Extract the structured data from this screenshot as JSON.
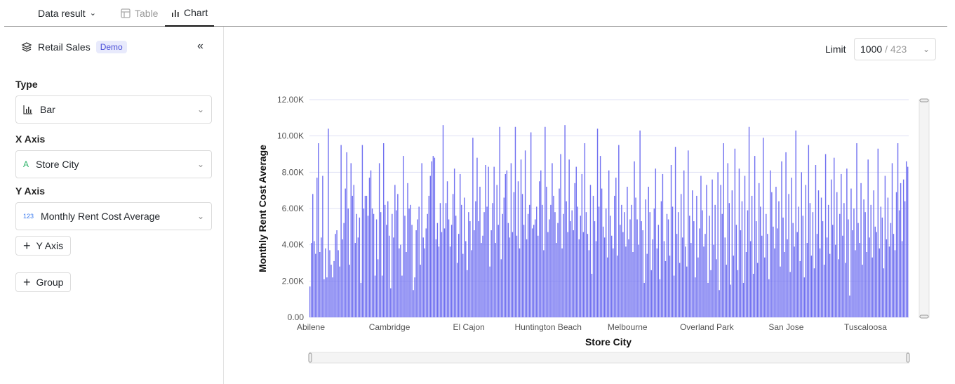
{
  "topbar": {
    "data_result": "Data result",
    "table_tab": "Table",
    "chart_tab": "Chart"
  },
  "sidebar": {
    "dataset": "Retail Sales",
    "badge": "Demo",
    "type_label": "Type",
    "type_value": "Bar",
    "x_label": "X Axis",
    "x_value": "Store City",
    "y_label": "Y Axis",
    "y_value": "Monthly Rent Cost Average",
    "y_type_icon": "123",
    "add_y": "Y Axis",
    "add_group": "Group"
  },
  "limit": {
    "label": "Limit",
    "value": "1000",
    "total": "/ 423"
  },
  "colors": {
    "bar": "#7070f0",
    "grid": "#dfe1f5"
  },
  "chart_data": {
    "type": "bar",
    "xlabel": "Store City",
    "ylabel": "Monthly Rent Cost Average",
    "ylim": [
      0,
      12000
    ],
    "yticks": [
      "0.00",
      "2.00K",
      "4.00K",
      "6.00K",
      "8.00K",
      "10.00K",
      "12.00K"
    ],
    "grid": true,
    "x_tick_labels": [
      {
        "index": 0,
        "label": "Abilene"
      },
      {
        "index": 56,
        "label": "Cambridge"
      },
      {
        "index": 112,
        "label": "El Cajon"
      },
      {
        "index": 168,
        "label": "Huntington Beach"
      },
      {
        "index": 224,
        "label": "Melbourne"
      },
      {
        "index": 280,
        "label": "Overland Park"
      },
      {
        "index": 336,
        "label": "San Jose"
      },
      {
        "index": 392,
        "label": "Tuscaloosa"
      }
    ],
    "values": [
      1700,
      4100,
      6800,
      4200,
      3500,
      7700,
      9600,
      3600,
      4400,
      7800,
      2100,
      3800,
      2200,
      10400,
      3700,
      2900,
      2200,
      3100,
      4600,
      4800,
      3700,
      2800,
      9500,
      4300,
      5200,
      7100,
      9100,
      6000,
      2900,
      8500,
      6700,
      7300,
      4100,
      5700,
      4400,
      5500,
      1900,
      9500,
      6000,
      6700,
      6700,
      5600,
      7700,
      8100,
      6000,
      5700,
      2300,
      5400,
      3200,
      8500,
      5800,
      2300,
      9600,
      6200,
      5100,
      6400,
      4500,
      1600,
      5700,
      4400,
      7300,
      5900,
      6800,
      3800,
      4000,
      2300,
      8900,
      5600,
      3600,
      7400,
      6000,
      6200,
      5100,
      1500,
      2200,
      4800,
      5400,
      6100,
      2900,
      8500,
      4400,
      3800,
      4900,
      5700,
      6700,
      7800,
      8600,
      8900,
      8800,
      4300,
      5200,
      3900,
      6300,
      4700,
      10600,
      4900,
      6300,
      7500,
      5400,
      3900,
      5100,
      6800,
      8200,
      5600,
      3000,
      4600,
      7900,
      6200,
      3500,
      6600,
      4200,
      2600,
      5800,
      5300,
      3700,
      9900,
      4800,
      6400,
      8800,
      5300,
      7200,
      4100,
      4500,
      5800,
      8400,
      6100,
      8300,
      2800,
      4800,
      6300,
      8300,
      4100,
      7300,
      5100,
      10500,
      3200,
      5700,
      6600,
      7900,
      8100,
      5200,
      4400,
      8500,
      4700,
      6900,
      10500,
      4500,
      7500,
      3800,
      8700,
      6800,
      5100,
      9200,
      4300,
      5700,
      6200,
      10200,
      4900,
      5100,
      5400,
      6100,
      4500,
      7500,
      8100,
      6200,
      3700,
      10500,
      7200,
      4700,
      5400,
      6200,
      8500,
      6700,
      5800,
      4100,
      5200,
      7100,
      9000,
      3800,
      5700,
      10600,
      6400,
      4700,
      8700,
      5300,
      5900,
      4800,
      7400,
      8300,
      6100,
      4300,
      5600,
      7900,
      4700,
      9600,
      5800,
      4600,
      3700,
      7300,
      2400,
      6700,
      5300,
      4200,
      10400,
      6100,
      8900,
      7100,
      5000,
      4400,
      6000,
      3300,
      8100,
      5600,
      4500,
      3800,
      6700,
      7700,
      3400,
      9500,
      5100,
      6200,
      4700,
      5800,
      3900,
      7200,
      4300,
      5400,
      6200,
      3600,
      8600,
      6600,
      5400,
      4000,
      10300,
      5300,
      4800,
      1900,
      6500,
      3500,
      7200,
      5800,
      2600,
      4300,
      6000,
      8200,
      3800,
      5100,
      2100,
      6400,
      7900,
      4200,
      3100,
      5700,
      5400,
      3400,
      8400,
      6100,
      2300,
      9400,
      4600,
      5800,
      3000,
      6800,
      4400,
      8100,
      3900,
      2800,
      9200,
      5600,
      4100,
      7000,
      5300,
      2200,
      6700,
      3300,
      4900,
      7800,
      5900,
      3900,
      4600,
      7300,
      1900,
      5600,
      2600,
      7600,
      4000,
      6200,
      3200,
      8000,
      1500,
      7300,
      5700,
      9600,
      4400,
      2900,
      8500,
      6300,
      1800,
      7000,
      3400,
      9300,
      5100,
      2600,
      8200,
      4800,
      6400,
      1900,
      7800,
      3600,
      5900,
      10500,
      4200,
      6700,
      2400,
      8900,
      5300,
      3000,
      7400,
      6100,
      4500,
      9900,
      3300,
      5700,
      4600,
      2100,
      8100,
      6900,
      5000,
      3800,
      7200,
      4900,
      6400,
      2800,
      8600,
      5500,
      3600,
      9100,
      4300,
      6800,
      2500,
      7700,
      5200,
      3900,
      10300,
      4700,
      6100,
      3100,
      8000,
      5600,
      2200,
      7300,
      4100,
      9500,
      6300,
      3400,
      5800,
      2700,
      8400,
      4600,
      7000,
      3800,
      6600,
      5300,
      2900,
      9000,
      4400,
      6200,
      3500,
      7600,
      5100,
      8800,
      4000,
      6900,
      3200,
      5700,
      7900,
      4500,
      6300,
      3000,
      8200,
      5400,
      1200,
      7100,
      4800,
      6000,
      3700,
      9600,
      5200,
      4100,
      7400,
      2900,
      6500,
      5800,
      3600,
      8700,
      4400,
      6200,
      3300,
      7000,
      5000,
      4700,
      9300,
      3800,
      6100,
      5500,
      2700,
      7800,
      4300,
      6600,
      3900,
      5200,
      8500,
      4600,
      3700,
      6900,
      9600,
      5900,
      7400,
      4200,
      7600,
      6400,
      8600,
      8300
    ]
  }
}
